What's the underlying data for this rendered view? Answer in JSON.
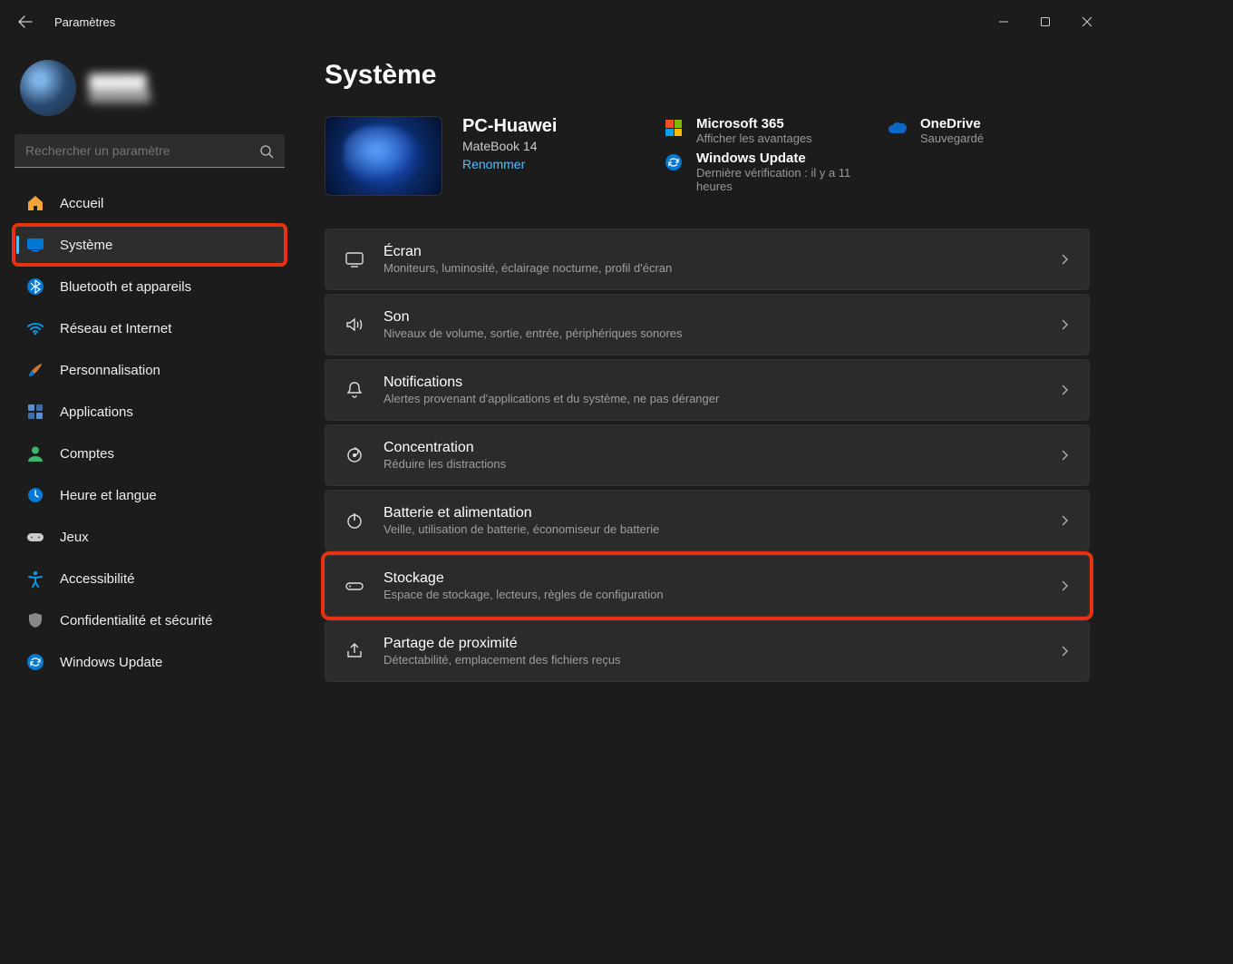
{
  "app": {
    "title": "Paramètres"
  },
  "profile": {
    "name": "██████",
    "email": "████████"
  },
  "search": {
    "placeholder": "Rechercher un paramètre"
  },
  "sidebar": {
    "items": [
      {
        "label": "Accueil"
      },
      {
        "label": "Système"
      },
      {
        "label": "Bluetooth et appareils"
      },
      {
        "label": "Réseau et Internet"
      },
      {
        "label": "Personnalisation"
      },
      {
        "label": "Applications"
      },
      {
        "label": "Comptes"
      },
      {
        "label": "Heure et langue"
      },
      {
        "label": "Jeux"
      },
      {
        "label": "Accessibilité"
      },
      {
        "label": "Confidentialité et sécurité"
      },
      {
        "label": "Windows Update"
      }
    ]
  },
  "page": {
    "title": "Système"
  },
  "device": {
    "name": "PC-Huawei",
    "model": "MateBook 14",
    "rename": "Renommer"
  },
  "status": {
    "m365": {
      "title": "Microsoft 365",
      "sub": "Afficher les avantages"
    },
    "onedrive": {
      "title": "OneDrive",
      "sub": "Sauvegardé"
    },
    "update": {
      "title": "Windows Update",
      "sub": "Dernière vérification : il y a 11 heures"
    }
  },
  "settings": [
    {
      "title": "Écran",
      "sub": "Moniteurs, luminosité, éclairage nocturne, profil d'écran"
    },
    {
      "title": "Son",
      "sub": "Niveaux de volume, sortie, entrée, périphériques sonores"
    },
    {
      "title": "Notifications",
      "sub": "Alertes provenant d'applications et du système, ne pas déranger"
    },
    {
      "title": "Concentration",
      "sub": "Réduire les distractions"
    },
    {
      "title": "Batterie et alimentation",
      "sub": "Veille, utilisation de batterie, économiseur de batterie"
    },
    {
      "title": "Stockage",
      "sub": "Espace de stockage, lecteurs, règles de configuration"
    },
    {
      "title": "Partage de proximité",
      "sub": "Détectabilité, emplacement des fichiers reçus"
    }
  ]
}
